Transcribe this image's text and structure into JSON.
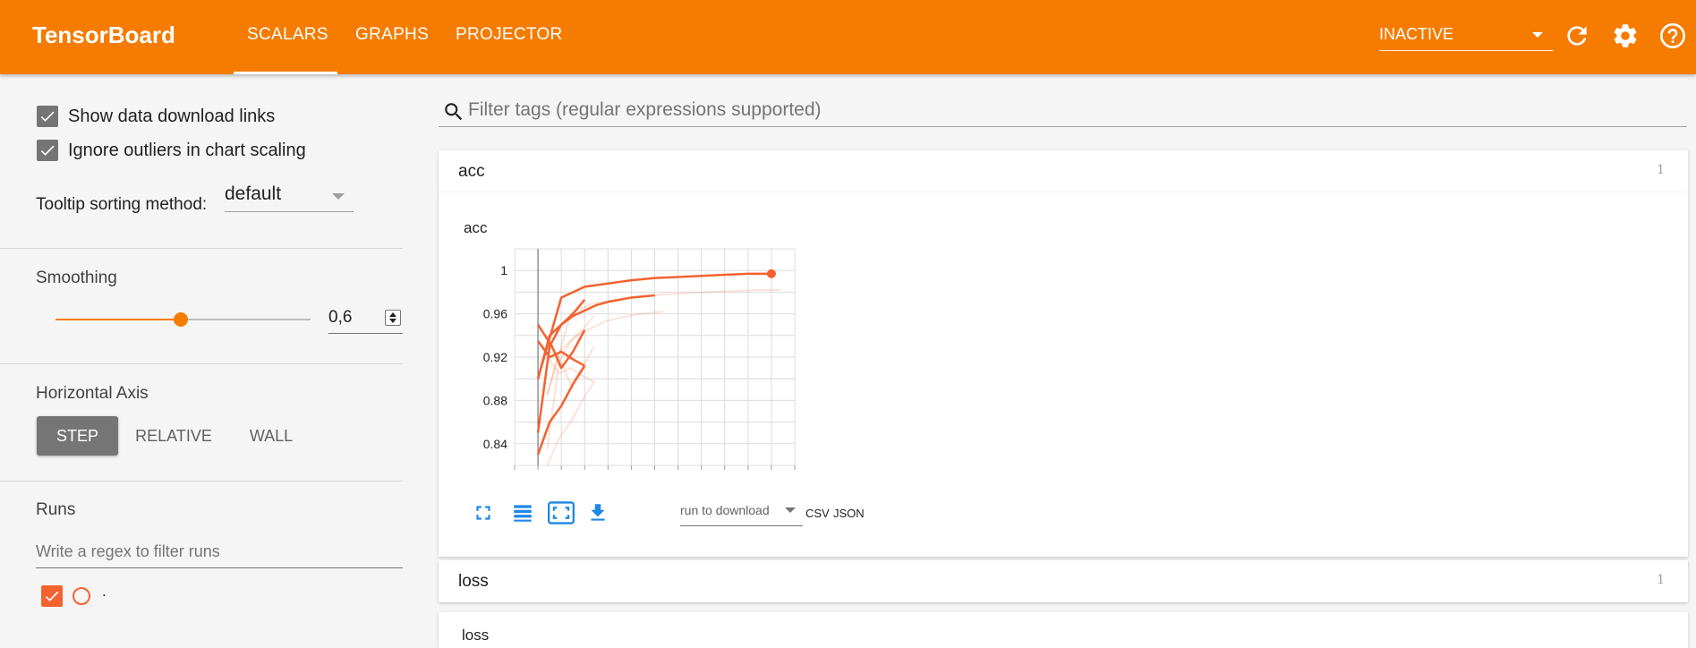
{
  "app": {
    "title": "TensorBoard",
    "tabs": [
      {
        "label": "SCALARS",
        "active": true
      },
      {
        "label": "GRAPHS",
        "active": false
      },
      {
        "label": "PROJECTOR",
        "active": false
      }
    ],
    "run_selector": "INACTIVE",
    "accent_color": "#f57c00",
    "icons": [
      "refresh-icon",
      "settings-icon",
      "help-icon"
    ]
  },
  "sidebar": {
    "show_download_links": {
      "label": "Show data download links",
      "checked": true
    },
    "ignore_outliers": {
      "label": "Ignore outliers in chart scaling",
      "checked": true
    },
    "tooltip_sorting": {
      "label": "Tooltip sorting method:",
      "value": "default"
    },
    "smoothing": {
      "label": "Smoothing",
      "value": "0,6",
      "level": 0.6
    },
    "horizontal_axis": {
      "label": "Horizontal Axis",
      "options": [
        "STEP",
        "RELATIVE",
        "WALL"
      ],
      "selected": "STEP"
    },
    "runs": {
      "label": "Runs",
      "filter_placeholder": "Write a regex to filter runs",
      "items": [
        {
          "name": ".",
          "checked": true
        }
      ]
    }
  },
  "main": {
    "filter_placeholder": "Filter tags (regular expressions supported)",
    "categories": [
      {
        "name": "acc",
        "count": "1"
      },
      {
        "name": "loss",
        "count": "1"
      }
    ],
    "card": {
      "title": "acc",
      "download_select": "run to download",
      "download_formats": [
        "CSV",
        "JSON"
      ],
      "icons": [
        "fullscreen-icon",
        "log-scale-icon",
        "fit-domain-icon",
        "download-icon"
      ]
    },
    "loss_card_title": "loss"
  },
  "chart_data": {
    "type": "line",
    "title": "acc",
    "xlabel": "",
    "ylabel": "",
    "y_ticks": [
      "1",
      "0.96",
      "0.92",
      "0.88",
      "0.84"
    ],
    "ylim": [
      0.82,
      1.02
    ],
    "grid": true,
    "series": [
      {
        "color": "#f4622f",
        "x": [
          0,
          1,
          2,
          3,
          4,
          5,
          6,
          7,
          8,
          9,
          10
        ],
        "values": [
          0.9,
          0.975,
          0.985,
          0.988,
          0.991,
          0.993,
          0.994,
          0.995,
          0.996,
          0.997,
          0.997
        ]
      },
      {
        "color": "#f4622f",
        "x": [
          0,
          0.5,
          1,
          1.5,
          2
        ],
        "values": [
          0.85,
          0.93,
          0.95,
          0.96,
          0.973
        ]
      },
      {
        "color": "#f4622f",
        "x": [
          0,
          0.5,
          1,
          1.5,
          2,
          2.5,
          3,
          3.5,
          4,
          5
        ],
        "values": [
          0.9,
          0.94,
          0.95,
          0.958,
          0.963,
          0.968,
          0.971,
          0.973,
          0.975,
          0.977
        ]
      },
      {
        "color": "#f4622f",
        "x": [
          0,
          0.5,
          1,
          1.5,
          2
        ],
        "values": [
          0.935,
          0.92,
          0.925,
          0.918,
          0.912
        ]
      },
      {
        "color": "#f4622f",
        "x": [
          0,
          0.5,
          1,
          1.5,
          2
        ],
        "values": [
          0.83,
          0.86,
          0.875,
          0.895,
          0.912
        ]
      },
      {
        "color": "#f4622f",
        "x": [
          0,
          0.3,
          0.6,
          1,
          1.5,
          2
        ],
        "values": [
          0.95,
          0.94,
          0.93,
          0.91,
          0.925,
          0.945
        ]
      }
    ],
    "highlight_point": {
      "x": 10,
      "value": 0.997
    }
  }
}
